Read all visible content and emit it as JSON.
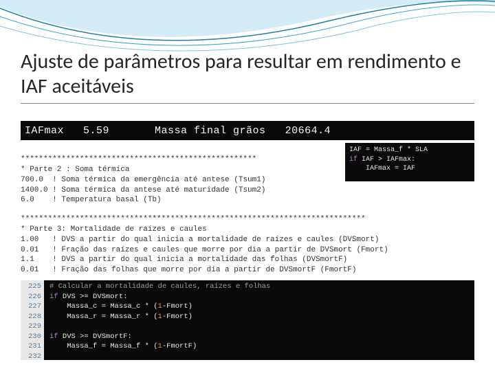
{
  "title": "Ajuste de parâmetros para resultar em rendimento e IAF aceitáveis",
  "output_bar": {
    "label1": "IAFmax",
    "value1": "5.59",
    "label2": "Massa final grãos",
    "value2": "20664.4"
  },
  "side_code": {
    "l1": "IAF = Massa_f * SLA",
    "l2a": "if",
    "l2b": " IAF > IAFmax:",
    "l3": "    IAFmax = IAF"
  },
  "params2": {
    "divider": "****************************************************",
    "header": "* Parte 2 : Soma térmica",
    "l1": "700.0  ! Soma térmica da emergência até antese (Tsum1)",
    "l2": "1400.0 ! Soma térmica da antese até maturidade (Tsum2)",
    "l3": "6.0    ! Temperatura basal (Tb)"
  },
  "params3": {
    "divider": "****************************************************************************",
    "header": "* Parte 3: Mortalidade de raízes e caules",
    "l1": "1.00   ! DVS a partir do qual inicia a mortalidade de raízes e caules (DVSmort)",
    "l2": "0.01   ! Fração das raízes e caules que morre por dia a partir de DVSmort (Fmort)",
    "l3": "1.1    ! DVS a partir do qual inicia a mortalidade das folhas (DVSmortF)",
    "l4": "0.01   ! Fração das folhas que morre por dia a partir de DVSmortF (FmortF)"
  },
  "gutter": [
    "225",
    "226",
    "227",
    "228",
    "229",
    "230",
    "231",
    "232"
  ],
  "code": {
    "c1": "# Calcular a mortalidade de caules, raízes e folhas",
    "k_if": "if",
    "l2": " DVS >= DVSmort:",
    "l3a": "    Massa_c = Massa_c * (",
    "l3n": "1",
    "l3b": "-Fmort)",
    "l4a": "    Massa_r = Massa_r * (",
    "l4n": "1",
    "l4b": "-Fmort)",
    "l6": " DVS >= DVSmortF:",
    "l7a": "    Massa_f = Massa_f * (",
    "l7n": "1",
    "l7b": "-FmortF)"
  }
}
